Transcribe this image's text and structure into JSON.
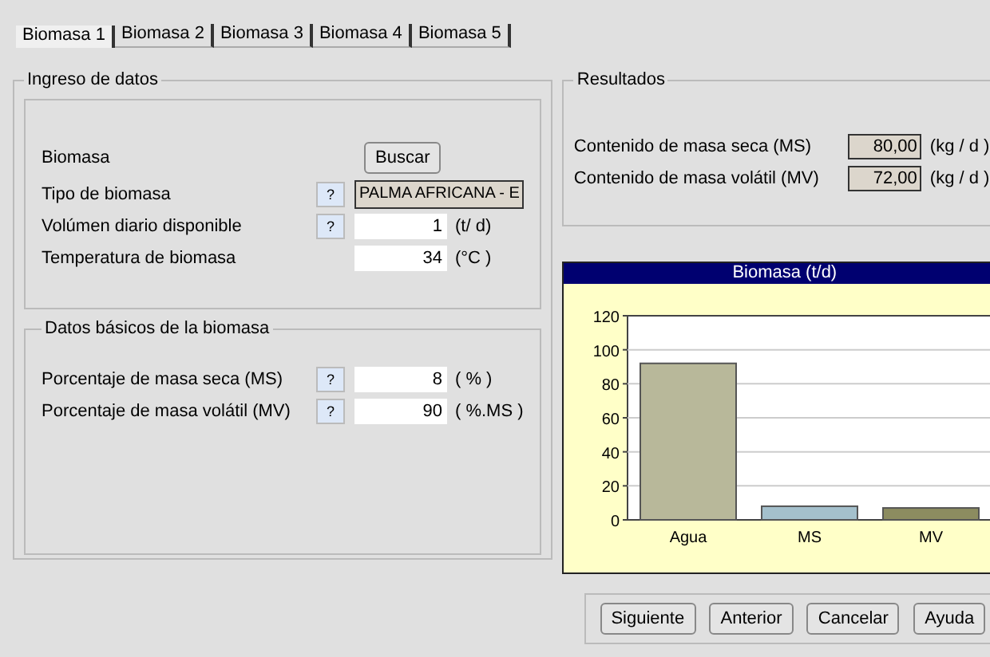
{
  "tabs": [
    {
      "label": "Biomasa 1",
      "selected": true
    },
    {
      "label": "Biomasa 2",
      "selected": false
    },
    {
      "label": "Biomasa  3",
      "selected": false
    },
    {
      "label": "Biomasa 4",
      "selected": false
    },
    {
      "label": "Biomasa 5",
      "selected": false
    }
  ],
  "input_group": {
    "title": "Ingreso de datos",
    "search_label": "Biomasa",
    "search_button": "Buscar",
    "fields": [
      {
        "label": "Tipo de biomasa",
        "help": "?",
        "value": "PALMA AFRICANA - E",
        "kind": "readonly"
      },
      {
        "label": "Volúmen diario disponible",
        "help": "?",
        "value": "1",
        "unit": "(t/ d)",
        "kind": "input"
      },
      {
        "label": "Temperatura de biomasa",
        "value": "34",
        "unit": "(°C )",
        "kind": "input"
      }
    ]
  },
  "basic_group": {
    "title": "Datos básicos de la biomasa",
    "fields": [
      {
        "label": "Porcentaje de masa seca (MS)",
        "help": "?",
        "value": "8",
        "unit": "( % )",
        "kind": "input"
      },
      {
        "label": "Porcentaje de masa volátil (MV)",
        "help": "?",
        "value": "90",
        "unit": "( %.MS )",
        "kind": "input"
      }
    ]
  },
  "results": {
    "title": "Resultados",
    "fields": [
      {
        "label": "Contenido de masa seca (MS)",
        "value": "80,00",
        "unit": "(kg / d )"
      },
      {
        "label": "Contenido de masa volátil (MV)",
        "value": "72,00",
        "unit": "(kg / d )"
      }
    ]
  },
  "chart": {
    "chart_data": {
      "type": "bar",
      "title": "Biomasa (t/d)",
      "grid": true,
      "stacked": true,
      "series": [
        {
          "name": "Agua",
          "color": "#b8b89a",
          "values": [
            92,
            null,
            null
          ]
        },
        {
          "name": "MS",
          "color": "#a4c0cc",
          "values": [
            null,
            8,
            null
          ]
        },
        {
          "name": "MV",
          "color": "#8c8c60",
          "values": [
            null,
            null,
            7
          ]
        }
      ],
      "ylim": [
        0,
        120
      ],
      "yticks": [
        0,
        20,
        40,
        60,
        80,
        100,
        120
      ]
    }
  },
  "buttons": [
    "Siguiente",
    "Anterior",
    "Cancelar",
    "Ayuda"
  ]
}
